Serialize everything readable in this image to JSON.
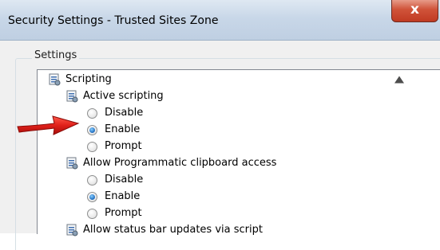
{
  "window": {
    "title": "Security Settings - Trusted Sites Zone",
    "close_glyph": "x"
  },
  "settings": {
    "group_label": "Settings",
    "tree": [
      {
        "kind": "category",
        "label": "Scripting",
        "icon": "settings-icon"
      },
      {
        "kind": "setting",
        "label": "Active scripting",
        "icon": "settings-icon"
      },
      {
        "kind": "option",
        "label": "Disable",
        "checked": false
      },
      {
        "kind": "option",
        "label": "Enable",
        "checked": true
      },
      {
        "kind": "option",
        "label": "Prompt",
        "checked": false
      },
      {
        "kind": "setting",
        "label": "Allow Programmatic clipboard access",
        "icon": "settings-icon"
      },
      {
        "kind": "option",
        "label": "Disable",
        "checked": false
      },
      {
        "kind": "option",
        "label": "Enable",
        "checked": true
      },
      {
        "kind": "option",
        "label": "Prompt",
        "checked": false
      },
      {
        "kind": "setting",
        "label": "Allow status bar updates via script",
        "icon": "settings-icon"
      }
    ]
  },
  "annotation": {
    "icon": "red-arrow-icon",
    "color": "#e0201a"
  },
  "colors": {
    "radio_selected": "#2a77c7",
    "close_button": "#c03a22"
  }
}
